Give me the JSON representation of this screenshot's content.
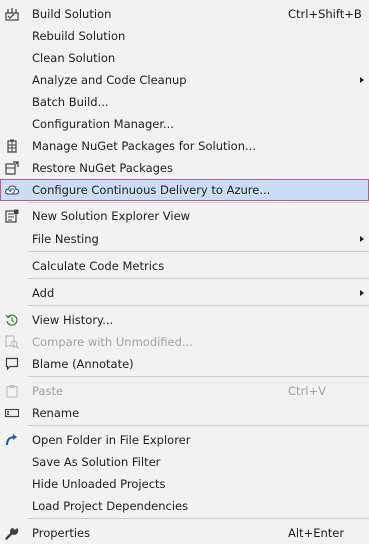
{
  "menu": {
    "items": [
      {
        "label": "Build Solution",
        "shortcut": "Ctrl+Shift+B",
        "icon": "build-icon"
      },
      {
        "label": "Rebuild Solution"
      },
      {
        "label": "Clean Solution"
      },
      {
        "label": "Analyze and Code Cleanup",
        "submenu": true
      },
      {
        "label": "Batch Build..."
      },
      {
        "label": "Configuration Manager..."
      },
      {
        "label": "Manage NuGet Packages for Solution...",
        "icon": "nuget-icon"
      },
      {
        "label": "Restore NuGet Packages",
        "icon": "restore-packages-icon"
      },
      {
        "label": "Configure Continuous Delivery to Azure...",
        "icon": "cloud-delivery-icon",
        "selected": true
      },
      {
        "label": "New Solution Explorer View",
        "icon": "new-view-icon"
      },
      {
        "label": "File Nesting",
        "submenu": true
      },
      {
        "label": "Calculate Code Metrics"
      },
      {
        "label": "Add",
        "submenu": true
      },
      {
        "label": "View History...",
        "icon": "history-icon"
      },
      {
        "label": "Compare with Unmodified...",
        "icon": "compare-icon",
        "disabled": true
      },
      {
        "label": "Blame (Annotate)",
        "icon": "comment-icon"
      },
      {
        "label": "Paste",
        "shortcut": "Ctrl+V",
        "icon": "paste-icon",
        "disabled": true
      },
      {
        "label": "Rename",
        "icon": "rename-icon"
      },
      {
        "label": "Open Folder in File Explorer",
        "icon": "open-folder-icon"
      },
      {
        "label": "Save As Solution Filter"
      },
      {
        "label": "Hide Unloaded Projects"
      },
      {
        "label": "Load Project Dependencies"
      },
      {
        "label": "Properties",
        "shortcut": "Alt+Enter",
        "icon": "wrench-icon"
      }
    ]
  },
  "colors": {
    "background": "#f2f2f2",
    "selected_background": "#c9def5",
    "selected_border": "#c9568f",
    "disabled_text": "#a2a2a2",
    "separator": "#cfcfcf"
  }
}
